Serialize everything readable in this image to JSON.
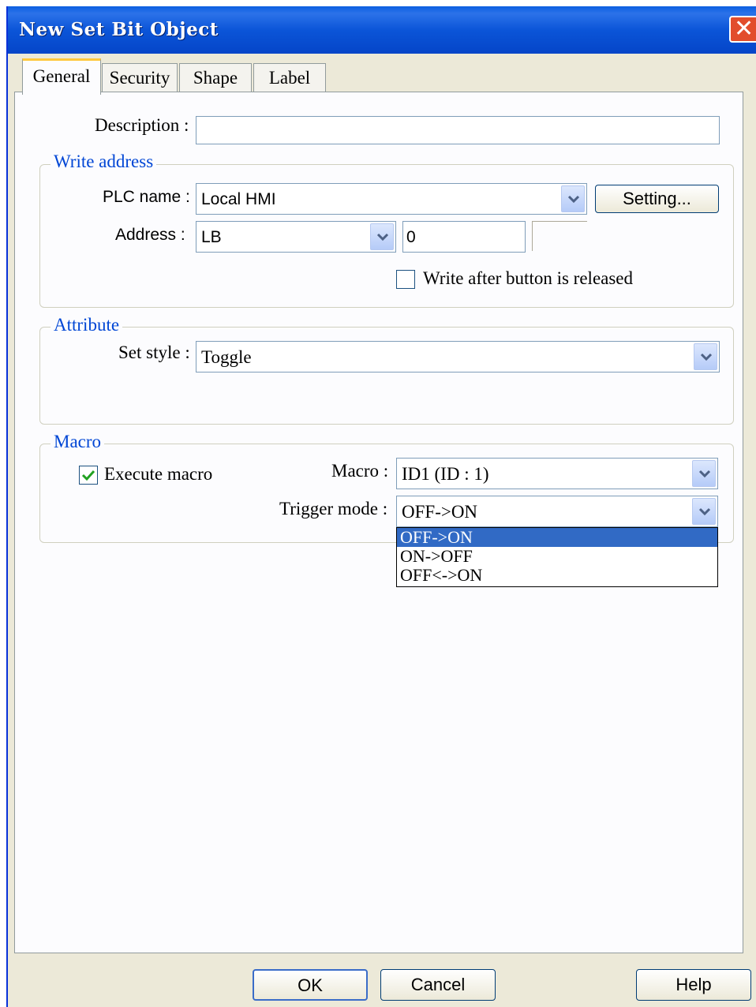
{
  "window": {
    "title": "New  Set Bit Object"
  },
  "tabs": [
    {
      "label": "General"
    },
    {
      "label": "Security"
    },
    {
      "label": "Shape"
    },
    {
      "label": "Label"
    }
  ],
  "description": {
    "label": "Description :",
    "value": ""
  },
  "write_address": {
    "title": "Write address",
    "plc_label": "PLC name :",
    "plc_value": "Local HMI",
    "setting_button": "Setting...",
    "address_label": "Address :",
    "device_value": "LB",
    "address_value": "0",
    "write_after_release_label": "Write after button is released",
    "write_after_release_checked": false
  },
  "attribute": {
    "title": "Attribute",
    "set_style_label": "Set style :",
    "set_style_value": "Toggle"
  },
  "macro": {
    "title": "Macro",
    "execute_label": "Execute macro",
    "execute_checked": true,
    "macro_label": "Macro :",
    "macro_value": "ID1 (ID : 1)",
    "trigger_label": "Trigger mode :",
    "trigger_value": "OFF->ON",
    "trigger_options": [
      "OFF->ON",
      "ON->OFF",
      "OFF<->ON"
    ],
    "trigger_selected_index": 0
  },
  "buttons": {
    "ok": "OK",
    "cancel": "Cancel",
    "help": "Help"
  },
  "colors": {
    "titlebar": "#0b55d8",
    "group_title": "#0046d5",
    "selection": "#316ac5",
    "close": "#e24d2c"
  }
}
